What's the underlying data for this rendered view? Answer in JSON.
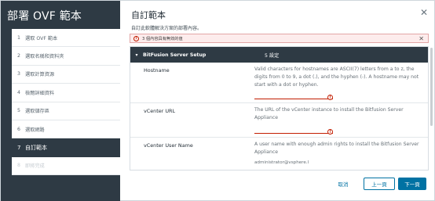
{
  "wizard": {
    "title": "部署 OVF 範本",
    "steps": [
      {
        "num": "1",
        "label": "選取 OVF 範本",
        "state": "normal"
      },
      {
        "num": "2",
        "label": "選取名稱和資料夾",
        "state": "normal"
      },
      {
        "num": "3",
        "label": "選取計算資源",
        "state": "normal"
      },
      {
        "num": "4",
        "label": "檢閱詳細資料",
        "state": "normal"
      },
      {
        "num": "5",
        "label": "選取儲存區",
        "state": "normal"
      },
      {
        "num": "6",
        "label": "選取網路",
        "state": "normal"
      },
      {
        "num": "7",
        "label": "自訂範本",
        "state": "active"
      },
      {
        "num": "8",
        "label": "即將完成",
        "state": "disabled"
      }
    ]
  },
  "page": {
    "title": "自訂範本",
    "subtitle": "自訂此軟體解決方案的部署內容。"
  },
  "alert": {
    "text": "3 個內容具有無效的值"
  },
  "section": {
    "name": "BitFusion Server Setup",
    "count": "5 設定"
  },
  "properties": [
    {
      "name": "Hostname",
      "description": "Valid characters for hostnames are ASCII(7) letters from a to z, the digits from 0 to 9, a dot (.), and the hyphen (-). A hostname may not start with a dot or hyphen.",
      "value": "",
      "invalid": true
    },
    {
      "name": "vCenter URL",
      "description": "The URL of the vCenter instance to install the Bitfusion Server Appliance",
      "value": "",
      "invalid": true
    },
    {
      "name": "vCenter User Name",
      "description": "A user name with enough admin rights to install the Bitfusion Server Appliance",
      "value": "administrator@vsphere.l",
      "invalid": false
    }
  ],
  "footer": {
    "cancel": "取消",
    "back": "上一頁",
    "next": "下一頁"
  },
  "icons": {
    "close": "close-icon",
    "error": "exclamation-circle-icon",
    "chevron": "chevron-down-icon"
  },
  "colors": {
    "sidebar": "#2e3a44",
    "primary": "#0072a3",
    "error": "#c21d00"
  }
}
